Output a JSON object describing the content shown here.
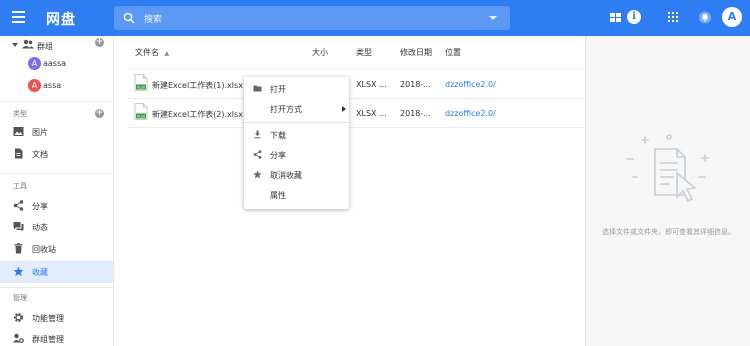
{
  "header": {
    "title": "网盘",
    "search_placeholder": "搜索",
    "info_label": "i",
    "avatar_letter": "A"
  },
  "sidebar": {
    "group_label": "群组",
    "users": [
      {
        "letter": "A",
        "name": "aassa",
        "color": "#7b6cf0"
      },
      {
        "letter": "A",
        "name": "assa",
        "color": "#ef5350"
      }
    ],
    "types_header": "类型",
    "types": [
      {
        "label": "图片",
        "icon": "image-icon"
      },
      {
        "label": "文档",
        "icon": "document-icon"
      }
    ],
    "tools_header": "工具",
    "tools": [
      {
        "label": "分享",
        "icon": "share-icon"
      },
      {
        "label": "动态",
        "icon": "activity-icon"
      },
      {
        "label": "回收站",
        "icon": "trash-icon"
      },
      {
        "label": "收藏",
        "icon": "star-icon",
        "active": true
      }
    ],
    "manage_header": "管理",
    "manage": [
      {
        "label": "功能管理",
        "icon": "gear-icon"
      },
      {
        "label": "群组管理",
        "icon": "group-settings-icon"
      }
    ]
  },
  "table": {
    "columns": {
      "name": "文件名",
      "size": "大小",
      "type": "类型",
      "modified": "修改日期",
      "location": "位置"
    },
    "sort_arrow": "▲",
    "rows": [
      {
        "name": "新建Excel工作表(1).xlsx",
        "type": "XLSX ...",
        "modified": "2018-...",
        "location": "dzzoffice2.0/"
      },
      {
        "name": "新建Excel工作表(2).xlsx",
        "type": "XLSX ...",
        "modified": "2018-...",
        "location": "dzzoffice2.0/"
      }
    ]
  },
  "context_menu": {
    "items": [
      {
        "label": "打开",
        "icon": "folder-icon"
      },
      {
        "label": "打开方式",
        "icon": "",
        "submenu": true
      },
      {
        "label": "下载",
        "icon": "download-icon"
      },
      {
        "label": "分享",
        "icon": "share-icon"
      },
      {
        "label": "取消收藏",
        "icon": "star-icon"
      },
      {
        "label": "属性",
        "icon": ""
      }
    ]
  },
  "right_panel": {
    "empty_text": "选择文件或文件夹，即可查看其详细信息。"
  },
  "colors": {
    "brand": "#2e7df3",
    "active_bg": "#e3ecfb"
  }
}
